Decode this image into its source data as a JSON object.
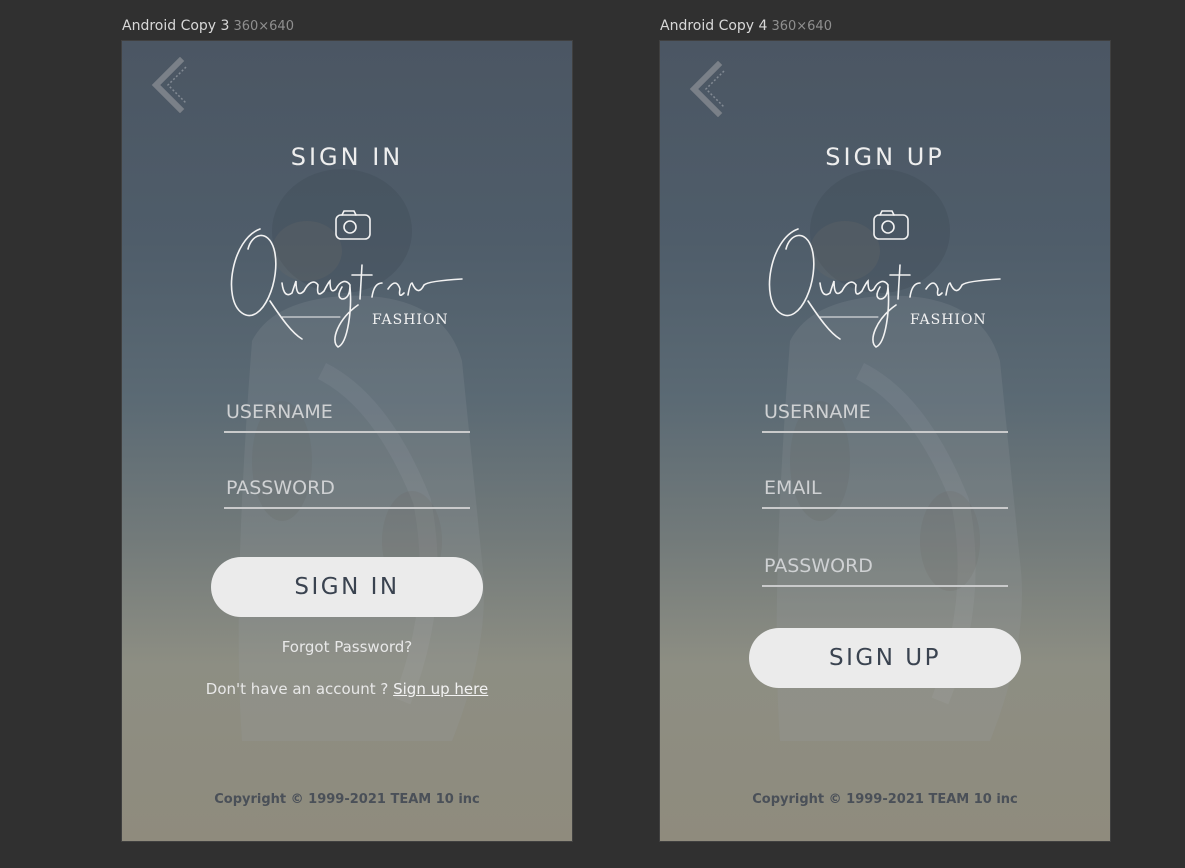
{
  "frames": [
    {
      "name": "Android Copy 3",
      "dims": "360×640",
      "title": "SIGN IN",
      "logo": {
        "script": "Quangtran",
        "sub": "FASHION"
      },
      "fields": [
        {
          "placeholder": "USERNAME"
        },
        {
          "placeholder": "PASSWORD"
        }
      ],
      "button": "SIGN IN",
      "forgot": "Forgot Password?",
      "signup_prompt": "Don't have an account ?",
      "signup_link": "Sign up here",
      "copyright": "Copyright © 1999-2021 TEAM 10 inc"
    },
    {
      "name": "Android Copy 4",
      "dims": "360×640",
      "title": "SIGN UP",
      "logo": {
        "script": "Quangtran",
        "sub": "FASHION"
      },
      "fields": [
        {
          "placeholder": "USERNAME"
        },
        {
          "placeholder": "EMAIL"
        },
        {
          "placeholder": "PASSWORD"
        }
      ],
      "button": "SIGN UP",
      "copyright": "Copyright © 1999-2021 TEAM 10 inc"
    }
  ],
  "colors": {
    "canvas": "#303030",
    "button_bg": "#ebebeb",
    "button_text": "#3a4350",
    "field_line": "#c9cacb"
  }
}
